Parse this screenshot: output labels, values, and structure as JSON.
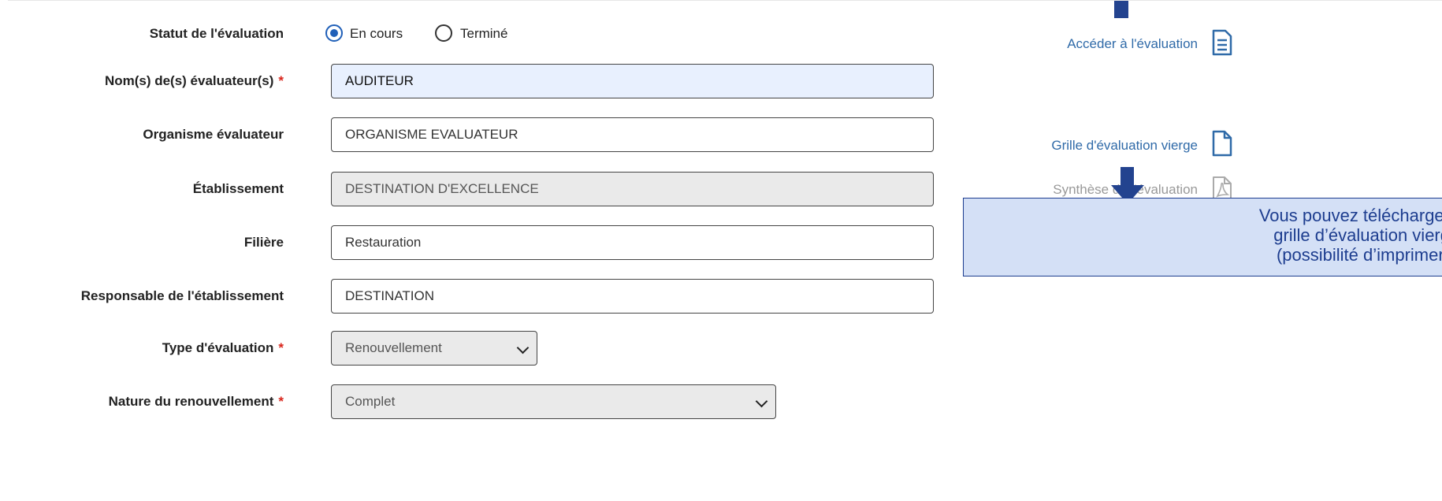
{
  "form": {
    "status": {
      "label": "Statut de l'évaluation",
      "options": [
        {
          "label": "En cours",
          "selected": true
        },
        {
          "label": "Terminé",
          "selected": false
        }
      ]
    },
    "evaluators": {
      "label": "Nom(s) de(s) évaluateur(s)",
      "required_mark": "*",
      "value": "AUDITEUR"
    },
    "organism": {
      "label": "Organisme évaluateur",
      "value": "ORGANISME EVALUATEUR"
    },
    "establishment": {
      "label": "Établissement",
      "value": "DESTINATION D'EXCELLENCE"
    },
    "sector": {
      "label": "Filière",
      "value": "Restauration"
    },
    "manager": {
      "label": "Responsable de l'établissement",
      "value": "DESTINATION"
    },
    "eval_type": {
      "label": "Type d'évaluation",
      "required_mark": "*",
      "value": "Renouvellement"
    },
    "renewal_nature": {
      "label": "Nature du renouvellement",
      "required_mark": "*",
      "value": "Complet"
    }
  },
  "links": {
    "access": {
      "label": "Accéder à l'évaluation",
      "icon": "document-lines-icon"
    },
    "blank_grid": {
      "label": "Grille d'évaluation vierge",
      "icon": "blank-document-icon"
    },
    "synthesis": {
      "label": "Synthèse de l'évaluation",
      "icon": "pdf-icon",
      "disabled": true
    }
  },
  "callout": {
    "lines": [
      "Vous pouvez télécharger",
      "grille d’évaluation vierg",
      "(possibilité d’imprimer)"
    ]
  },
  "colors": {
    "accent": "#1f5fb8",
    "link": "#2f6aa8",
    "annotation": "#23438f",
    "callout_bg": "#d4e0f6",
    "required": "#d9261c"
  }
}
